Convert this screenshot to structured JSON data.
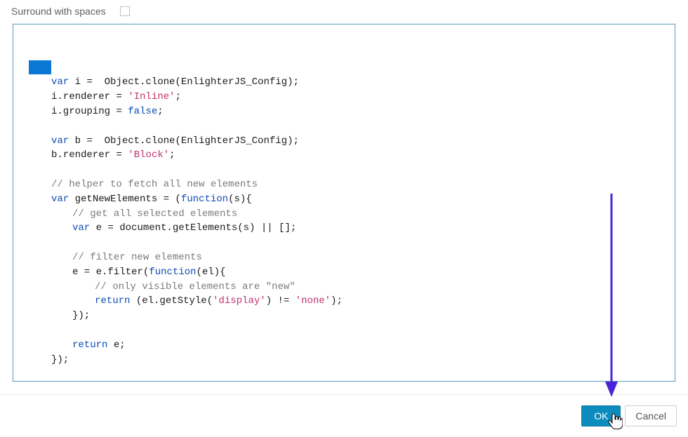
{
  "options": {
    "surround_label": "Surround with spaces",
    "surround_checked": false
  },
  "code": {
    "lines": [
      {
        "indent": 1,
        "segments": [
          {
            "t": "var ",
            "c": "kw"
          },
          {
            "t": "i = ",
            "c": "id"
          },
          {
            "t": " Object.clone(EnlighterJS_Config);",
            "c": "fnc"
          }
        ]
      },
      {
        "indent": 1,
        "segments": [
          {
            "t": "i.renderer = ",
            "c": "id"
          },
          {
            "t": "'Inline'",
            "c": "str"
          },
          {
            "t": ";",
            "c": "id"
          }
        ]
      },
      {
        "indent": 1,
        "segments": [
          {
            "t": "i.grouping = ",
            "c": "id"
          },
          {
            "t": "false",
            "c": "bool"
          },
          {
            "t": ";",
            "c": "id"
          }
        ]
      },
      {
        "indent": 1,
        "segments": [
          {
            "t": "",
            "c": "id"
          }
        ]
      },
      {
        "indent": 1,
        "segments": [
          {
            "t": "var ",
            "c": "kw"
          },
          {
            "t": "b = ",
            "c": "id"
          },
          {
            "t": " Object.clone(EnlighterJS_Config);",
            "c": "fnc"
          }
        ]
      },
      {
        "indent": 1,
        "segments": [
          {
            "t": "b.renderer = ",
            "c": "id"
          },
          {
            "t": "'Block'",
            "c": "str"
          },
          {
            "t": ";",
            "c": "id"
          }
        ]
      },
      {
        "indent": 1,
        "segments": [
          {
            "t": "",
            "c": "id"
          }
        ]
      },
      {
        "indent": 1,
        "segments": [
          {
            "t": "// helper to fetch all new elements",
            "c": "cmt"
          }
        ]
      },
      {
        "indent": 1,
        "segments": [
          {
            "t": "var ",
            "c": "kw"
          },
          {
            "t": "getNewElements = (",
            "c": "id"
          },
          {
            "t": "function",
            "c": "kw"
          },
          {
            "t": "(s){",
            "c": "id"
          }
        ]
      },
      {
        "indent": 2,
        "segments": [
          {
            "t": "// get all selected elements",
            "c": "cmt"
          }
        ]
      },
      {
        "indent": 2,
        "segments": [
          {
            "t": "var ",
            "c": "kw"
          },
          {
            "t": "e = document.getElements(s) || [];",
            "c": "id"
          }
        ]
      },
      {
        "indent": 2,
        "segments": [
          {
            "t": "",
            "c": "id"
          }
        ]
      },
      {
        "indent": 2,
        "segments": [
          {
            "t": "// filter new elements",
            "c": "cmt"
          }
        ]
      },
      {
        "indent": 2,
        "segments": [
          {
            "t": "e = e.filter(",
            "c": "id"
          },
          {
            "t": "function",
            "c": "kw"
          },
          {
            "t": "(el){",
            "c": "id"
          }
        ]
      },
      {
        "indent": 3,
        "segments": [
          {
            "t": "// only visible elements are \"new\"",
            "c": "cmt"
          }
        ]
      },
      {
        "indent": 3,
        "segments": [
          {
            "t": "return ",
            "c": "kw"
          },
          {
            "t": "(el.getStyle(",
            "c": "id"
          },
          {
            "t": "'display'",
            "c": "str"
          },
          {
            "t": ") != ",
            "c": "id"
          },
          {
            "t": "'none'",
            "c": "str"
          },
          {
            "t": ");",
            "c": "id"
          }
        ]
      },
      {
        "indent": 2,
        "segments": [
          {
            "t": "});",
            "c": "id"
          }
        ]
      },
      {
        "indent": 2,
        "segments": [
          {
            "t": "",
            "c": "id"
          }
        ]
      },
      {
        "indent": 2,
        "segments": [
          {
            "t": "return ",
            "c": "kw"
          },
          {
            "t": "e;",
            "c": "id"
          }
        ]
      },
      {
        "indent": 1,
        "segments": [
          {
            "t": "});",
            "c": "id"
          }
        ]
      }
    ],
    "highlight_line_index": 2
  },
  "buttons": {
    "ok_label": "OK",
    "cancel_label": "Cancel"
  },
  "annotation": {
    "arrow_color": "#4a24d6"
  }
}
